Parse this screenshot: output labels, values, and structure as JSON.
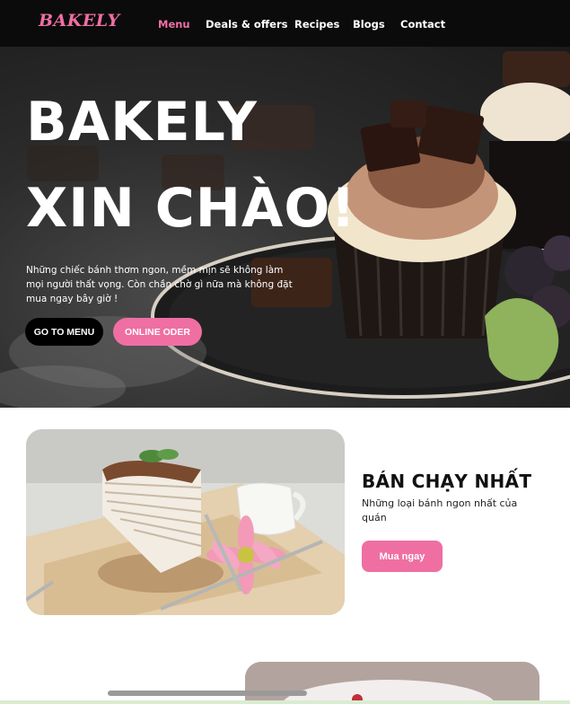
{
  "brand": {
    "logo": "BAKELY",
    "accent": "#ef6fa3"
  },
  "nav": {
    "items": [
      {
        "label": "Menu",
        "active": true
      },
      {
        "label": "Deals & offers",
        "active": false
      },
      {
        "label": "Recipes",
        "active": false
      },
      {
        "label": "Blogs",
        "active": false
      },
      {
        "label": "Contact",
        "active": false
      }
    ]
  },
  "hero": {
    "title_line1": "BAKELY",
    "title_line2": "XIN CHÀO!",
    "description": "Những chiếc bánh thơm ngon, mềm mịn sẽ không làm mọi người thất vọng. Còn chần chờ gì nữa mà không đặt mua ngay bây giờ !",
    "go_to_menu": "GO TO MENU",
    "online_order": "ONLINE ODER"
  },
  "best_seller": {
    "title": "BÁN CHẠY NHẤT",
    "subtitle": "Những loại bánh ngon nhất của quán",
    "buy_button": "Mua ngay"
  }
}
